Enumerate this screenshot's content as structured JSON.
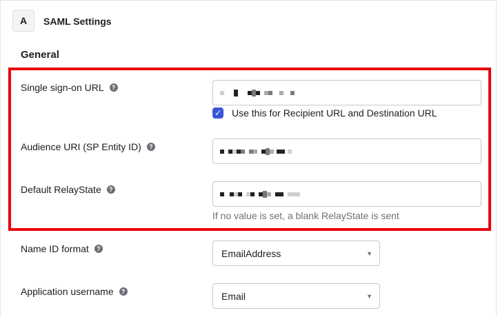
{
  "header": {
    "step_letter": "A",
    "step_title": "SAML Settings"
  },
  "section": {
    "title": "General"
  },
  "fields": {
    "sso_url": {
      "label": "Single sign-on URL",
      "help": "?"
    },
    "use_for_recipient": {
      "label": "Use this for Recipient URL and Destination URL",
      "checked": true
    },
    "audience_uri": {
      "label": "Audience URI (SP Entity ID)",
      "help": "?"
    },
    "relay_state": {
      "label": "Default RelayState",
      "help": "?",
      "hint": "If no value is set, a blank RelayState is sent"
    },
    "name_id_format": {
      "label": "Name ID format",
      "help": "?",
      "selected": "EmailAddress"
    },
    "app_username": {
      "label": "Application username",
      "help": "?",
      "selected": "Email"
    }
  },
  "icons": {
    "help": "question-circle-icon",
    "check": "checkmark-icon",
    "dropdown": "triangle-down-icon"
  },
  "colors": {
    "highlight_border": "#e8000b",
    "checkbox": "#3a56d6",
    "hint_text": "#6e6e78"
  }
}
